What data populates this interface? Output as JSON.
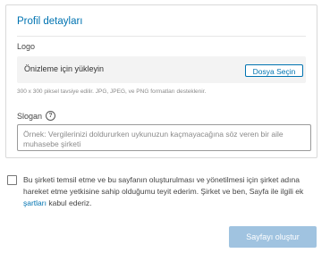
{
  "profile": {
    "title": "Profil detayları",
    "logo_label": "Logo",
    "upload_text": "Önizleme için yükleyin",
    "choose_file_label": "Dosya Seçin",
    "logo_help": "300 x 300 piksel tavsiye edilir. JPG, JPEG, ve PNG formatları desteklenir.",
    "slogan_label": "Slogan",
    "slogan_placeholder": "Örnek: Vergilerinizi doldururken uykunuzun kaçmayacağına söz veren bir aile muhasebe şirketi"
  },
  "consent": {
    "text_before": "Bu şirketi temsil etme ve bu sayfanın oluşturulması ve yönetilmesi için şirket adına hareket etme yetkisine sahip olduğumu teyit ederim. Şirket ve ben, Sayfa ile ilgili ek ",
    "terms_link": "şartları",
    "text_after": " kabul ederiz.",
    "checked": false
  },
  "actions": {
    "create_page_label": "Sayfayı oluştur"
  },
  "colors": {
    "accent": "#0073b1",
    "disabled_button": "#a0c3e0"
  }
}
